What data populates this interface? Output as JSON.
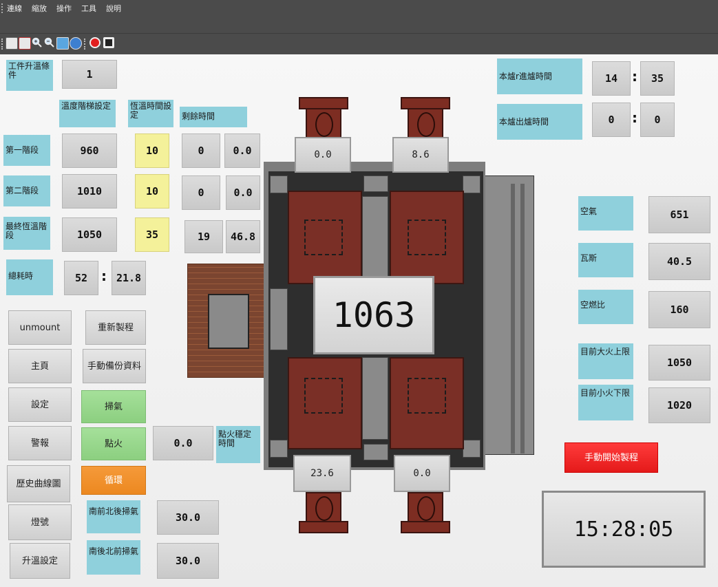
{
  "menu": {
    "items": [
      "連線",
      "縮放",
      "操作",
      "工具",
      "說明"
    ]
  },
  "toolbar": {
    "icons": [
      "layout-icon",
      "layout-red-icon",
      "zoom-in-icon",
      "zoom-out-icon",
      "fit-icon",
      "help-icon",
      "record-icon",
      "stop-icon"
    ]
  },
  "left": {
    "workpiece_label": "工件升溫條件",
    "workpiece_value": "1",
    "hdr_temp": "溫度階梯設定",
    "hdr_hold": "恆溫時間設定",
    "hdr_remain": "剩餘時間",
    "stages": [
      {
        "label": "第一階段",
        "temp": "960",
        "hold": "10",
        "remain_a": "0",
        "remain_b": "0.0"
      },
      {
        "label": "第二階段",
        "temp": "1010",
        "hold": "10",
        "remain_a": "0",
        "remain_b": "0.0"
      },
      {
        "label": "最終恆溫階段",
        "temp": "1050",
        "hold": "35",
        "remain_a": "19",
        "remain_b": "46.8"
      }
    ],
    "total_label": "總耗時",
    "total_a": "52",
    "total_b": "21.8",
    "colon": ":"
  },
  "buttons": {
    "unmount": "unmount",
    "restart": "重新製程",
    "home": "主頁",
    "backup": "手動備份資料",
    "settings": "設定",
    "purge": "掃氣",
    "alarm": "警報",
    "ignite": "點火",
    "cycle": "循環",
    "history": "歷史曲線圖",
    "lights": "燈號",
    "heat_settings": "升溫設定",
    "manual_start": "手動開始製程"
  },
  "ignition": {
    "value": "0.0",
    "label": "點火穩定時間"
  },
  "purge_times": {
    "sn_label": "南前北後掃氣",
    "sn_value": "30.0",
    "ns_label": "南後北前掃氣",
    "ns_value": "30.0"
  },
  "furnace": {
    "top_left": "0.0",
    "top_right": "8.6",
    "bottom_left": "23.6",
    "bottom_right": "0.0",
    "main_temp": "1063"
  },
  "right": {
    "in_label": "本爐r進爐時間",
    "in_h": "14",
    "in_m": "35",
    "out_label": "本爐出爐時間",
    "out_h": "0",
    "out_m": "0",
    "air_label": "空氣",
    "air_value": "651",
    "gas_label": "瓦斯",
    "gas_value": "40.5",
    "ratio_label": "空燃比",
    "ratio_value": "160",
    "upper_label": "目前大火上限",
    "upper_value": "1050",
    "lower_label": "目前小火下限",
    "lower_value": "1020"
  },
  "clock": "15:28:05",
  "colors": {
    "label_bg": "#8fd0dc",
    "yellow": "#f4f19a",
    "green": "#a5e09a",
    "orange": "#ec8820",
    "red": "#e41a1a",
    "furnace_brown": "#7a2f26"
  }
}
